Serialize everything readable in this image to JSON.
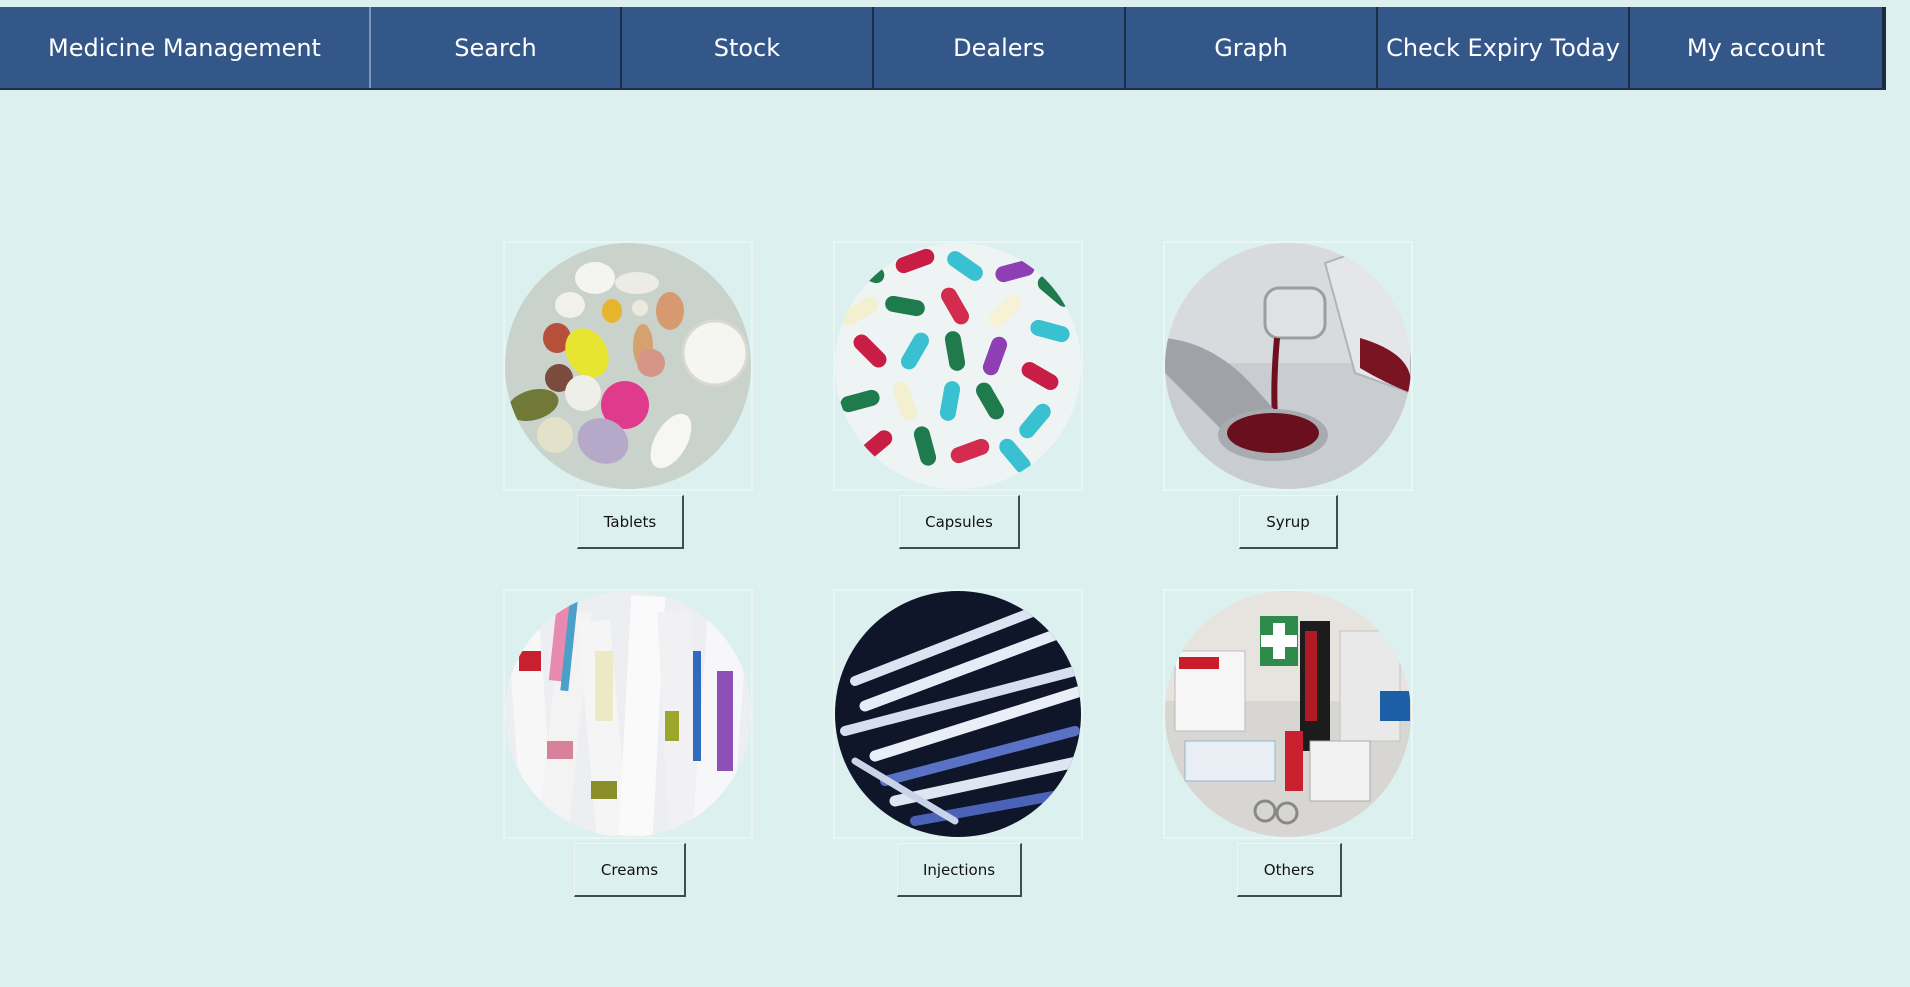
{
  "nav": {
    "brand": "Medicine Management",
    "items": [
      "Search",
      "Stock",
      "Dealers",
      "Graph",
      "Check Expiry Today",
      "My account"
    ]
  },
  "categories": [
    {
      "label": "Tablets",
      "image": "tablets-image"
    },
    {
      "label": "Capsules",
      "image": "capsules-image"
    },
    {
      "label": "Syrup",
      "image": "syrup-image"
    },
    {
      "label": "Creams",
      "image": "creams-image"
    },
    {
      "label": "Injections",
      "image": "injections-image"
    },
    {
      "label": "Others",
      "image": "others-image"
    }
  ],
  "colors": {
    "navbar": "#34578a",
    "background": "#dcf1ef",
    "nav_text": "#ffffff"
  }
}
